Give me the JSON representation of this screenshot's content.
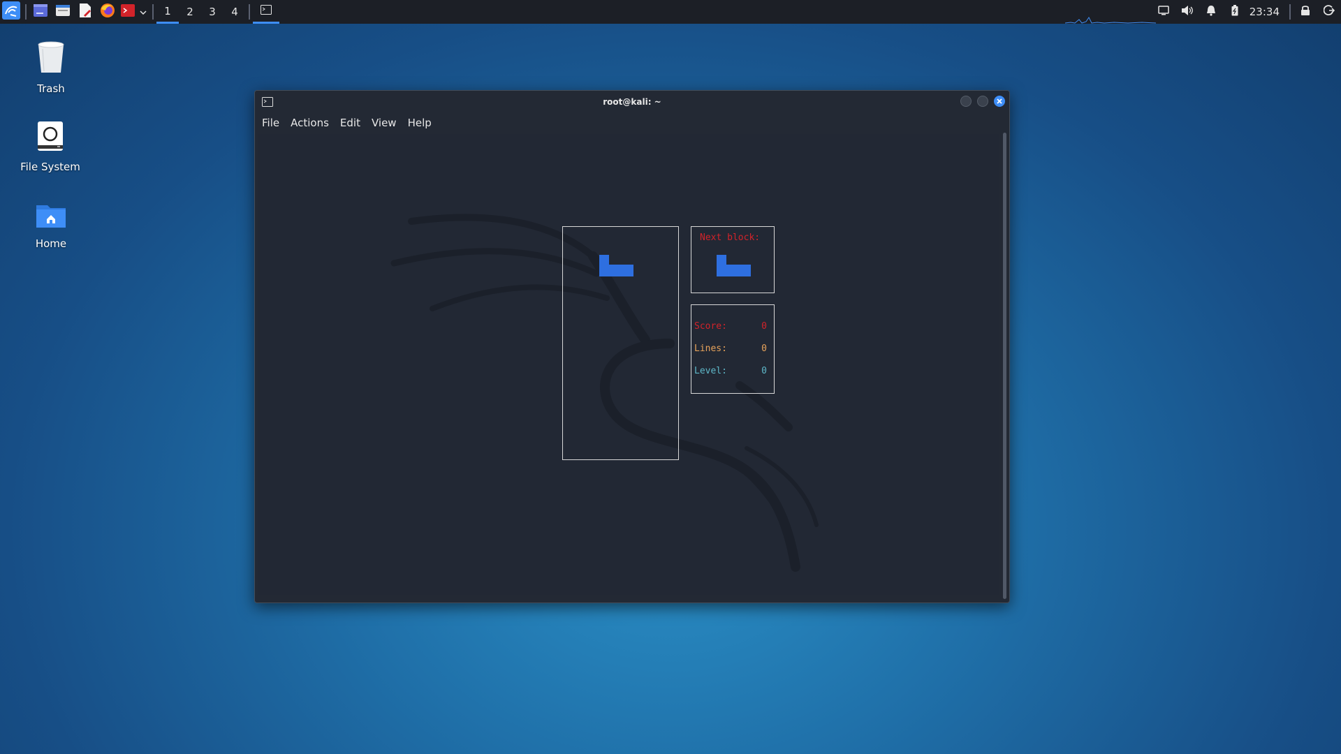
{
  "panel": {
    "workspaces": [
      "1",
      "2",
      "3",
      "4"
    ],
    "active_workspace": "1",
    "clock": "23:34",
    "accent_color": "#3e8ef7",
    "icons": [
      "kali-menu-icon",
      "terminal-launcher-icon",
      "file-manager-icon",
      "text-editor-icon",
      "firefox-icon",
      "root-terminal-icon",
      "chevron-down-icon",
      "window-task-terminal-icon",
      "display-icon",
      "volume-icon",
      "notification-bell-icon",
      "battery-icon",
      "lock-icon",
      "logout-icon"
    ]
  },
  "desktop": {
    "icons": [
      {
        "label": "Trash",
        "icon": "trash-icon"
      },
      {
        "label": "File System",
        "icon": "drive-icon"
      },
      {
        "label": "Home",
        "icon": "home-folder-icon"
      }
    ]
  },
  "window": {
    "title": "root@kali: ~",
    "menu": [
      "File",
      "Actions",
      "Edit",
      "View",
      "Help"
    ]
  },
  "tetris": {
    "next_label": "Next block:",
    "stats": [
      {
        "label": "Score:",
        "value": "0",
        "color": "#d2232a"
      },
      {
        "label": "Lines:",
        "value": "0",
        "color": "#e8a35b"
      },
      {
        "label": "Level:",
        "value": "0",
        "color": "#5fb8c9"
      }
    ],
    "piece_color": "#2e6fe0",
    "current_piece": "J",
    "next_piece": "J"
  }
}
